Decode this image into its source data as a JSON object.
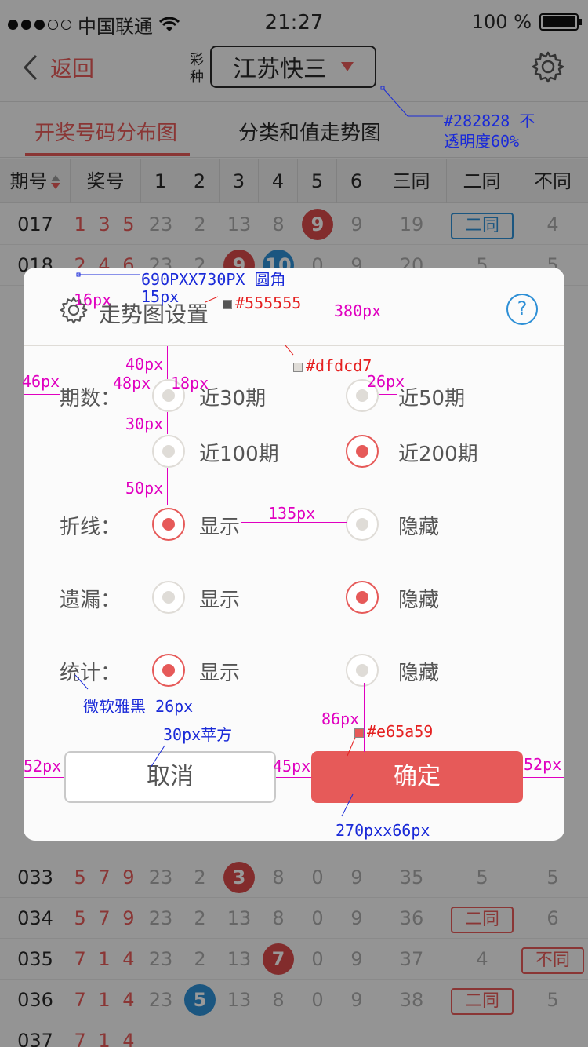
{
  "status": {
    "carrier": "中国联通",
    "time": "21:27",
    "battery": "100 %"
  },
  "nav": {
    "back": "返回",
    "lottery_label": "彩种",
    "lottery": "江苏快三"
  },
  "tabs": [
    "开奖号码分布图",
    "分类和值走势图"
  ],
  "table": {
    "headers": [
      "期号",
      "奖号",
      "1",
      "2",
      "3",
      "4",
      "5",
      "6",
      "三同",
      "二同",
      "不同"
    ],
    "rows": [
      {
        "q": "017",
        "n": "1 3 5",
        "c": [
          "23",
          "2",
          "13",
          "8",
          "9",
          "9",
          "19",
          "二同",
          "4"
        ]
      },
      {
        "q": "018",
        "n": "2 4 6",
        "c": [
          "23",
          "2",
          "9",
          "10",
          "0",
          "9",
          "20",
          "5",
          "5"
        ]
      },
      {
        "q": "033",
        "n": "5 7 9",
        "c": [
          "23",
          "2",
          "3",
          "8",
          "0",
          "9",
          "35",
          "5",
          "5"
        ]
      },
      {
        "q": "034",
        "n": "5 7 9",
        "c": [
          "23",
          "2",
          "13",
          "8",
          "0",
          "9",
          "36",
          "二同",
          "6"
        ]
      },
      {
        "q": "035",
        "n": "7 1 4",
        "c": [
          "23",
          "2",
          "13",
          "7",
          "0",
          "9",
          "37",
          "4",
          "不同"
        ]
      },
      {
        "q": "036",
        "n": "7 1 4",
        "c": [
          "23",
          "5",
          "13",
          "8",
          "0",
          "9",
          "38",
          "二同",
          "5"
        ]
      },
      {
        "q": "037",
        "n": "7 1 4",
        "c": [
          "",
          "",
          "",
          "",
          "",
          "",
          "",
          "",
          ""
        ]
      }
    ]
  },
  "dialog": {
    "title": "走势图设置",
    "help": "?",
    "periods_label": "期数：",
    "periods": [
      "近30期",
      "近50期",
      "近100期",
      "近200期"
    ],
    "line_label": "折线：",
    "missing_label": "遗漏：",
    "stats_label": "统计：",
    "show": "显示",
    "hide": "隐藏",
    "cancel": "取消",
    "confirm": "确定"
  },
  "annotations": {
    "opacity_note": "#282828 不",
    "opacity_note2": "透明度60%",
    "size_note": "690PXX730PX 圆角",
    "radius": "15px",
    "pad16": "16px",
    "title_color": "#555555",
    "w380": "380px",
    "divider_color": "#dfdcd7",
    "m40": "40px",
    "m46": "46px",
    "m48": "48px",
    "m18": "18px",
    "m26": "26px",
    "m30": "30px",
    "m50": "50px",
    "m135": "135px",
    "font_note": "微软雅黑 26px",
    "m86": "86px",
    "accent_color": "#e65a59",
    "btn_font": "30px苹方",
    "m52": "52px",
    "m45": "45px",
    "m52b": "52px",
    "btn_size": "270pxx66px"
  },
  "colors": {
    "accent": "#e65a59",
    "text": "#555555",
    "divider": "#dfdcd7",
    "dark": "#282828"
  }
}
